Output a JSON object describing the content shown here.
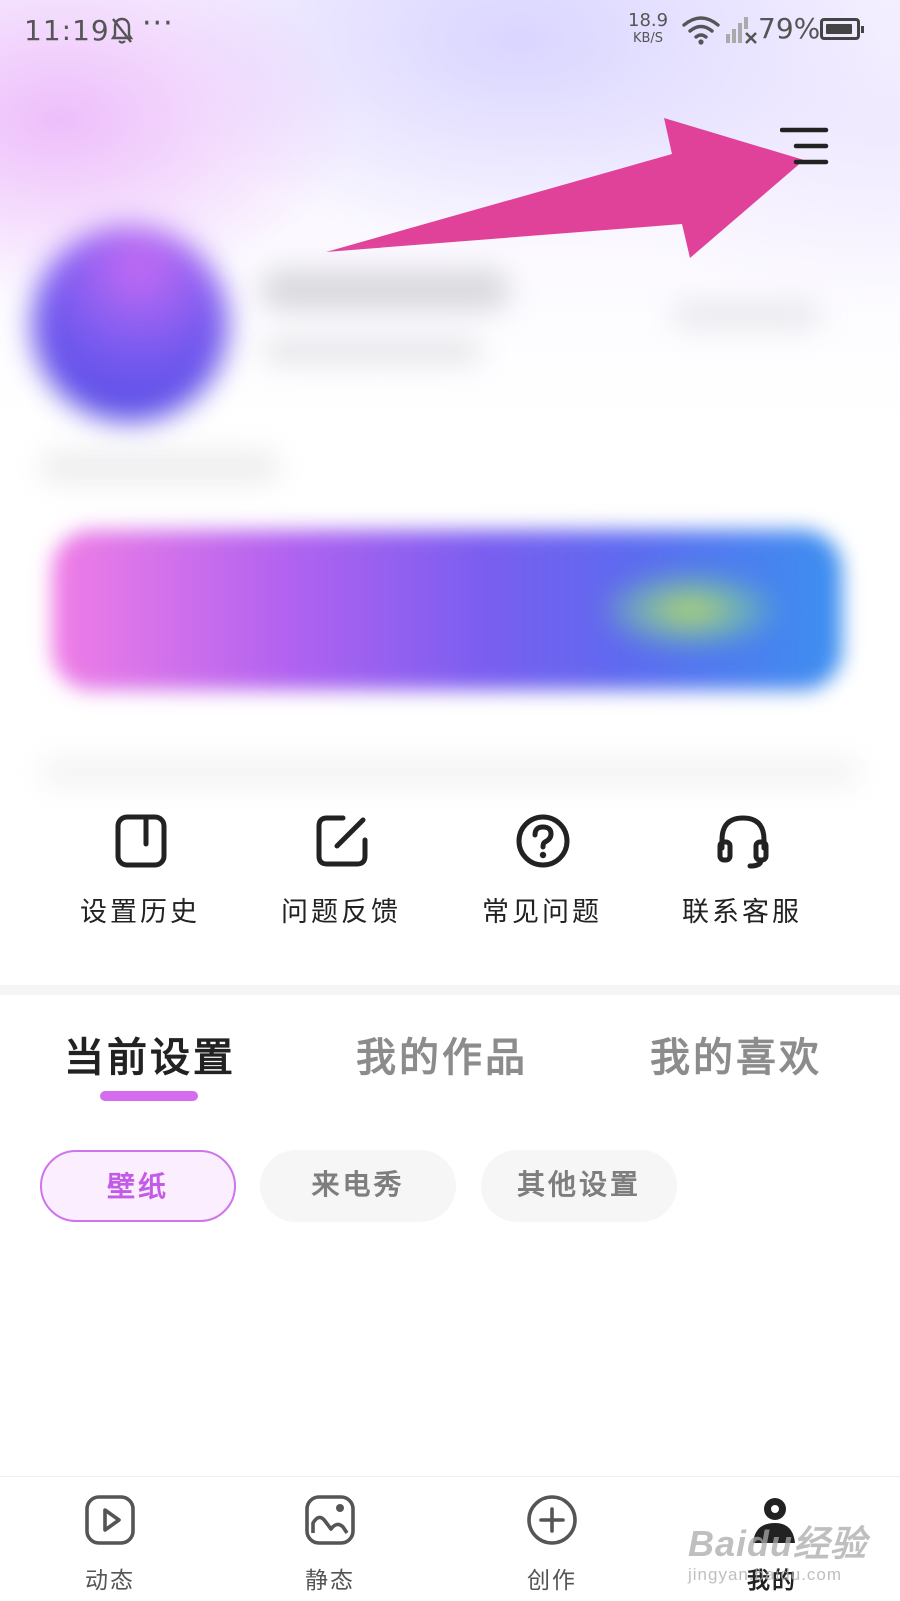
{
  "status_bar": {
    "time": "11:19",
    "dots": "···",
    "net_speed_value": "18.9",
    "net_speed_unit": "KB/S",
    "battery": "79%"
  },
  "header": {
    "menu_icon": "hamburger-menu-icon",
    "annotation": "pink arrow pointing to menu icon"
  },
  "quick_actions": [
    {
      "label": "设置历史",
      "icon": "history-icon"
    },
    {
      "label": "问题反馈",
      "icon": "feedback-edit-icon"
    },
    {
      "label": "常见问题",
      "icon": "question-icon"
    },
    {
      "label": "联系客服",
      "icon": "headset-icon"
    }
  ],
  "tabs": [
    {
      "label": "当前设置",
      "active": true
    },
    {
      "label": "我的作品",
      "active": false
    },
    {
      "label": "我的喜欢",
      "active": false
    }
  ],
  "chips": [
    {
      "label": "壁纸",
      "active": true
    },
    {
      "label": "来电秀",
      "active": false
    },
    {
      "label": "其他设置",
      "active": false
    }
  ],
  "bottom_nav": [
    {
      "label": "动态",
      "icon": "play-icon",
      "active": false
    },
    {
      "label": "静态",
      "icon": "image-icon",
      "active": false
    },
    {
      "label": "创作",
      "icon": "plus-circle-icon",
      "active": false
    },
    {
      "label": "我的",
      "icon": "user-icon",
      "active": true
    }
  ],
  "watermark": {
    "main": "Baidu经验",
    "sub": "jingyan.baidu.com"
  },
  "colors": {
    "accent": "#d46cf0",
    "chip_active_text": "#c45be6",
    "arrow": "#e0429a",
    "text_primary": "#222222",
    "text_inactive": "#8c8c8c"
  }
}
